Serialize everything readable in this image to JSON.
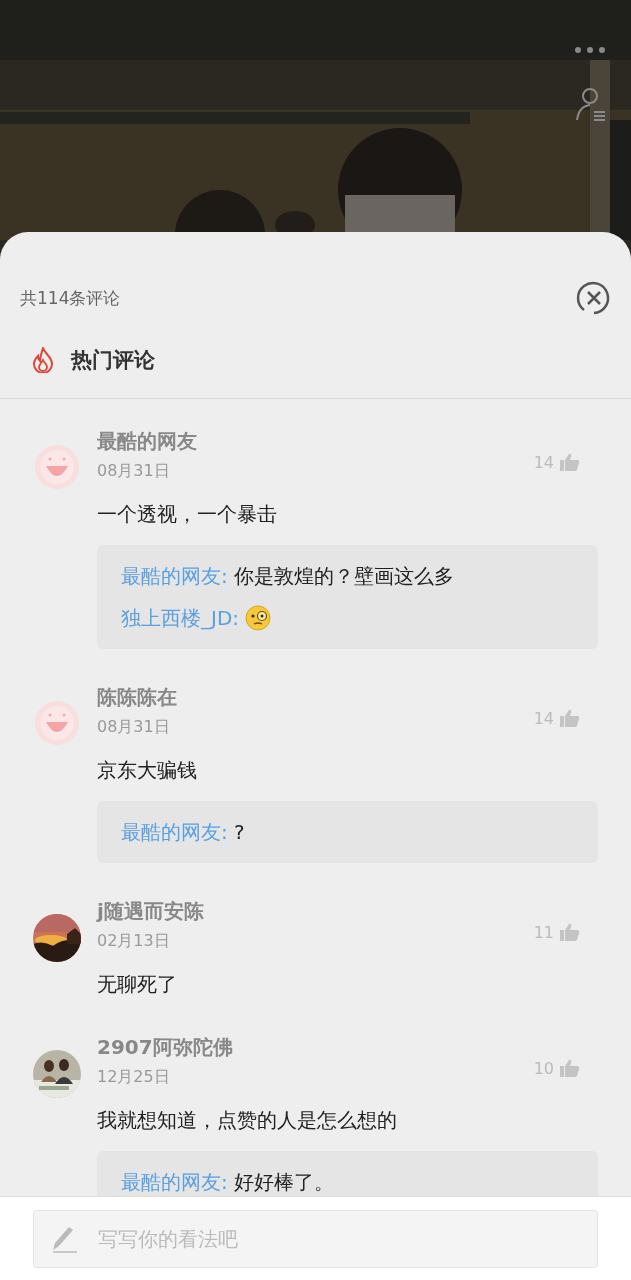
{
  "header": {
    "count": "共114条评论"
  },
  "section": {
    "title": "热门评论"
  },
  "comments": [
    {
      "name": "最酷的网友",
      "avatar": {
        "kind": "default"
      },
      "date": "08月31日",
      "likes": "14",
      "text": "一个透视，一个暴击",
      "replies": [
        {
          "kind": "text",
          "author": "最酷的网友:",
          "text": " 你是敦煌的？壁画这么多"
        },
        {
          "kind": "emoji",
          "author": "独上西楼_JD:"
        }
      ]
    },
    {
      "name": "陈陈陈在",
      "avatar": {
        "kind": "default"
      },
      "date": "08月31日",
      "likes": "14",
      "text": "京东大骗钱",
      "replies": [
        {
          "kind": "text",
          "author": "最酷的网友:",
          "text": " ?"
        }
      ]
    },
    {
      "name": "j随遇而安陈",
      "avatar": {
        "kind": "picture"
      },
      "date": "02月13日",
      "likes": "11",
      "text": "无聊死了"
    },
    {
      "name": "2907阿弥陀佛",
      "avatar": {
        "kind": "picture"
      },
      "date": "12月25日",
      "likes": "10",
      "text": "我就想知道，点赞的人是怎么想的",
      "replies": [
        {
          "kind": "text",
          "author": "最酷的网友:",
          "text": " 好好棒了。"
        }
      ]
    }
  ],
  "composer": {
    "placeholder": "写写你的看法吧"
  }
}
